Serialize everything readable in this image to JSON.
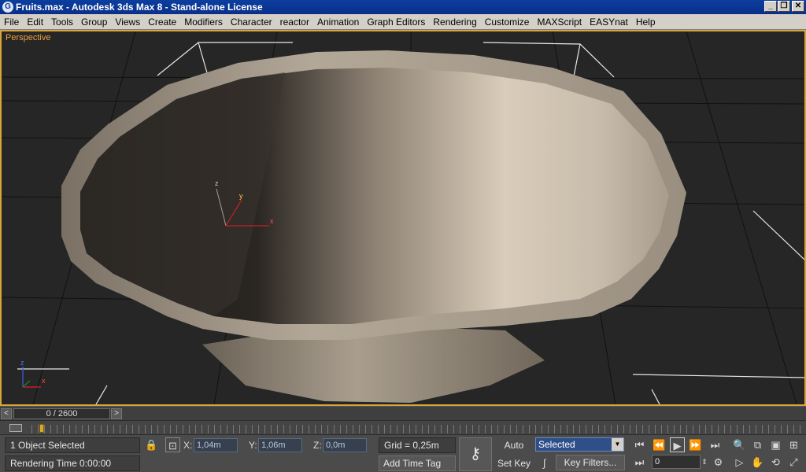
{
  "window": {
    "title": "Fruits.max - Autodesk 3ds Max 8  - Stand-alone License",
    "app_icon": "3ds-max-logo-icon",
    "controls": [
      "minimize-icon",
      "restore-icon",
      "close-icon"
    ]
  },
  "menu": [
    "File",
    "Edit",
    "Tools",
    "Group",
    "Views",
    "Create",
    "Modifiers",
    "Character",
    "reactor",
    "Animation",
    "Graph Editors",
    "Rendering",
    "Customize",
    "MAXScript",
    "EASYnat",
    "Help"
  ],
  "viewport": {
    "label": "Perspective",
    "border_color": "#d6a637",
    "background": "#262626",
    "object": "bowl",
    "gizmo_axes": {
      "x": "x",
      "y": "y",
      "z": "z"
    },
    "corner_axes": {
      "x": "x",
      "z": "z"
    }
  },
  "timeline": {
    "position_text": "0 / 2600",
    "prev": "<",
    "next": ">"
  },
  "status": {
    "selection": "1 Object Selected",
    "prompt": "Rendering Time  0:00:00",
    "x_label": "X:",
    "x_value": "1,04m",
    "y_label": "Y:",
    "y_value": "1,06m",
    "z_label": "Z:",
    "z_value": "0,0m",
    "grid": "Grid = 0,25m",
    "add_time_tag": "Add Time Tag",
    "auto_key": "Auto Key",
    "set_key": "Set Key",
    "key_filters": "Key Filters...",
    "key_mode": "Selected",
    "frame": "0",
    "accent": "#2e4f88"
  }
}
